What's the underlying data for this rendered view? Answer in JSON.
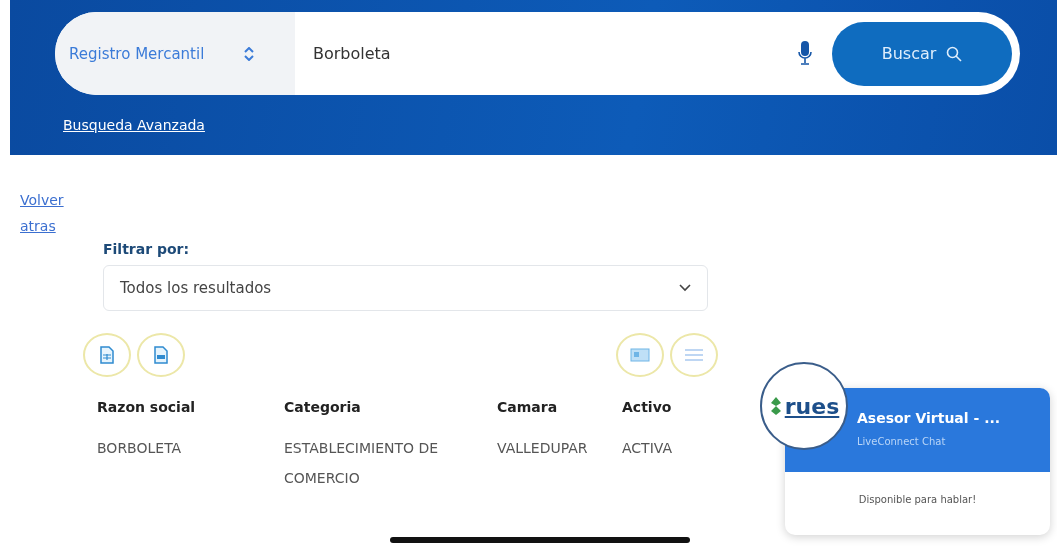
{
  "search": {
    "registry": "Registro Mercantil",
    "query": "Borboleta",
    "button": "Buscar",
    "advanced_link": "Busqueda Avanzada"
  },
  "back_link": "Volver atras",
  "filter": {
    "label": "Filtrar por:",
    "value": "Todos los resultados"
  },
  "export_buttons": [
    {
      "kind": "xls"
    },
    {
      "kind": "txt"
    }
  ],
  "view_buttons": [
    {
      "kind": "cards",
      "selected": false
    },
    {
      "kind": "list",
      "selected": false
    }
  ],
  "table": {
    "columns": [
      "Razon social",
      "Categoria",
      "Camara",
      "Activo"
    ],
    "rows": [
      [
        "BORBOLETA",
        "ESTABLECIMIENTO DE COMERCIO",
        "VALLEDUPAR",
        "ACTIVA"
      ]
    ]
  },
  "chat": {
    "logo": "rues",
    "title": "Asesor Virtual - ...",
    "subtitle": "LiveConnect Chat",
    "status": "Disponible para hablar!"
  }
}
